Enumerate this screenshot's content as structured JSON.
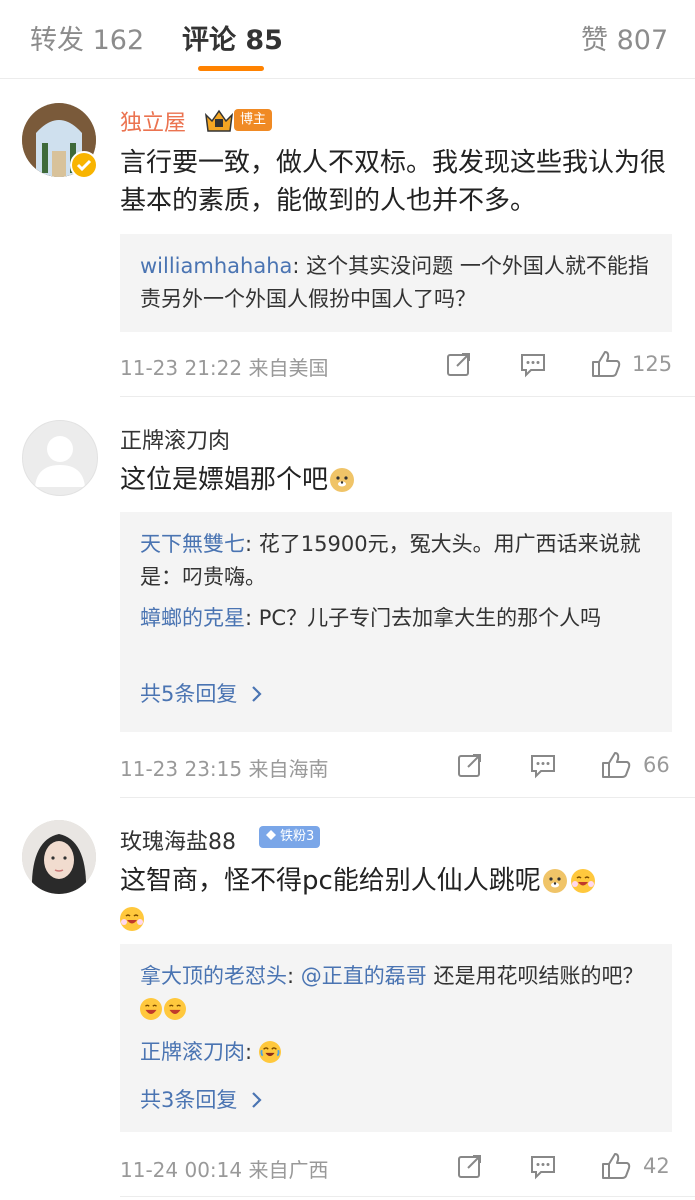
{
  "tabs": {
    "repost": "转发 162",
    "comment": "评论 85",
    "like": "赞 807"
  },
  "comments": [
    {
      "user": "独立屋",
      "badge": "博主",
      "text": "言行要一致，做人不双标。我发现这些我认为很基本的素质，能做到的人也并不多。",
      "replies": [
        {
          "name": "williamhahaha",
          "sep": ": ",
          "text": "这个其实没问题  一个外国人就不能指责另外一个外国人假扮中国人了吗？"
        }
      ],
      "time": "11-23 21:22",
      "source": "来自美国",
      "likes": "125"
    },
    {
      "user": "正牌滚刀肉",
      "text": "这位是嫖娼那个吧",
      "replies": [
        {
          "name": "天下無雙七",
          "sep": ": ",
          "text": "花了15900元，冤大头。用广西话来说就是：叼贵嗨。"
        },
        {
          "name": "蟑螂的克星",
          "sep": ": ",
          "text": "PC？儿子专门去加拿大生的那个人吗"
        }
      ],
      "more": "共5条回复",
      "time": "11-23 23:15",
      "source": "来自海南",
      "likes": "66"
    },
    {
      "user": "玫瑰海盐88",
      "badge": "铁粉3",
      "text": "这智商，怪不得pc能给别人仙人跳呢",
      "replies": [
        {
          "name": "拿大顶的老怼头",
          "sep": ": ",
          "mention": "@正直的磊哥",
          "text": "  还是用花呗结账的吧？"
        },
        {
          "name": "正牌滚刀肉",
          "sep": ": ",
          "text": ""
        }
      ],
      "more": "共3条回复",
      "time": "11-24 00:14",
      "source": "来自广西",
      "likes": "42"
    }
  ],
  "colors": {
    "accent": "#ff8200",
    "link": "#4a74b2",
    "muted": "#999999"
  },
  "icons": [
    "share-icon",
    "comment-icon",
    "like-icon",
    "chevron-right-icon",
    "doge-emoji-icon",
    "laugh-emoji-icon",
    "cry-laugh-emoji-icon"
  ]
}
